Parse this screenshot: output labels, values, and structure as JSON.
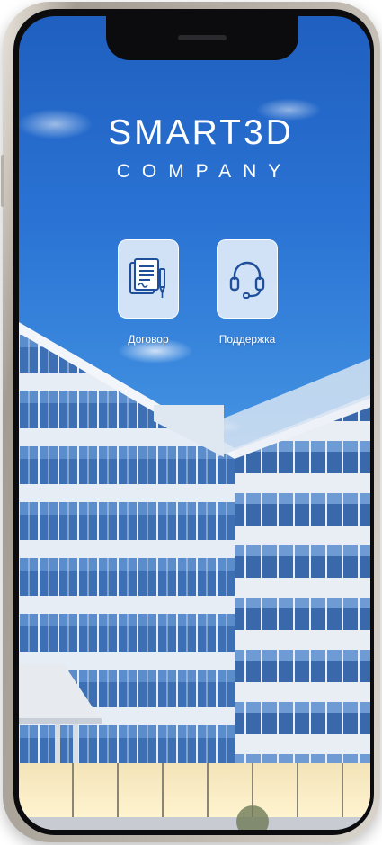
{
  "app": {
    "brand_name": "SMART3D",
    "brand_sub": "COMPANY"
  },
  "menu": {
    "items": [
      {
        "label": "Договор",
        "icon": "contract-document-pen-icon"
      },
      {
        "label": "Поддержка",
        "icon": "headset-icon"
      }
    ]
  },
  "colors": {
    "sky_top": "#1f5fbf",
    "sky_bottom": "#9ccaf0",
    "tile_background": "#ffffff",
    "icon_stroke": "#1f4f9a",
    "phone_frame": "#bdb6ad"
  }
}
